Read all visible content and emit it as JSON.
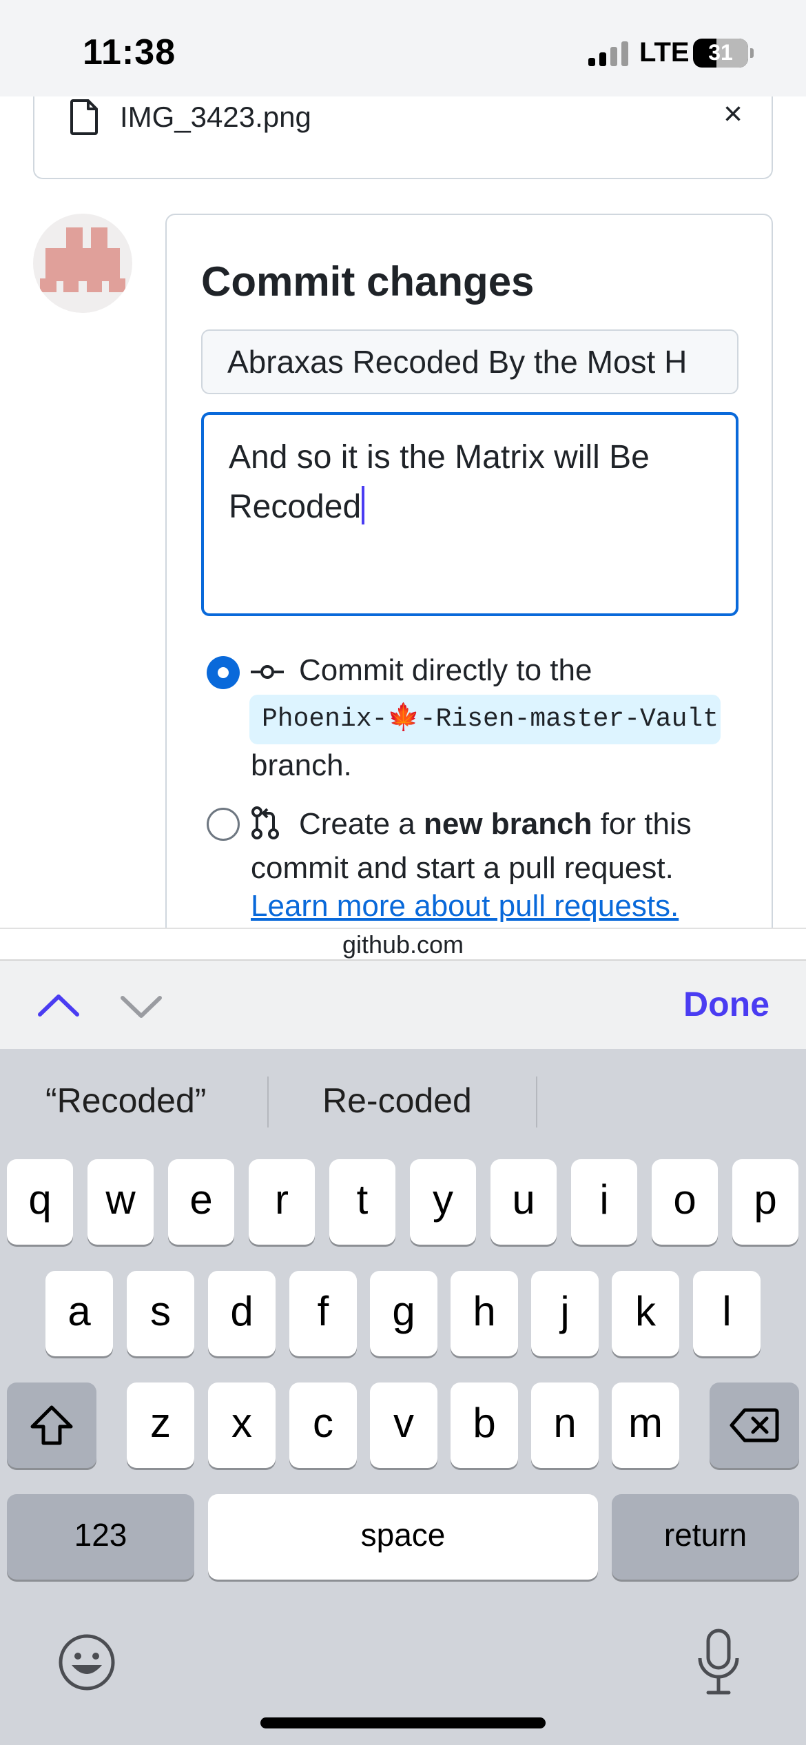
{
  "status_bar": {
    "time": "11:38",
    "network": "LTE",
    "battery": "31"
  },
  "file": {
    "name": "IMG_3423.png",
    "close_glyph": "×",
    "icon": "file-icon"
  },
  "commit": {
    "title": "Commit changes",
    "summary_value": "Abraxas Recoded By the Most H",
    "description_value": "And so it is the Matrix will Be Recoded",
    "option_direct": {
      "text_before": "Commit directly to the",
      "branch": "Phoenix-🍁-Risen-master-Vault",
      "text_after": "branch.",
      "checked": true
    },
    "option_new_branch": {
      "text_start": "Create a ",
      "bold": "new branch",
      "text_end": " for this commit and start a pull request.",
      "link": "Learn more about pull requests.",
      "checked": false
    }
  },
  "browser": {
    "url": "github.com"
  },
  "accessory_bar": {
    "done_label": "Done"
  },
  "keyboard": {
    "suggestions": [
      "“Recoded”",
      "Re-coded",
      ""
    ],
    "row1": [
      "q",
      "w",
      "e",
      "r",
      "t",
      "y",
      "u",
      "i",
      "o",
      "p"
    ],
    "row2": [
      "a",
      "s",
      "d",
      "f",
      "g",
      "h",
      "j",
      "k",
      "l"
    ],
    "row3": [
      "z",
      "x",
      "c",
      "v",
      "b",
      "n",
      "m"
    ],
    "numbers_label": "123",
    "space_label": "space",
    "return_label": "return"
  },
  "colors": {
    "accent": "#0969da",
    "keyboard_accent": "#4a3cf2",
    "branch_bg": "#ddf4ff"
  }
}
